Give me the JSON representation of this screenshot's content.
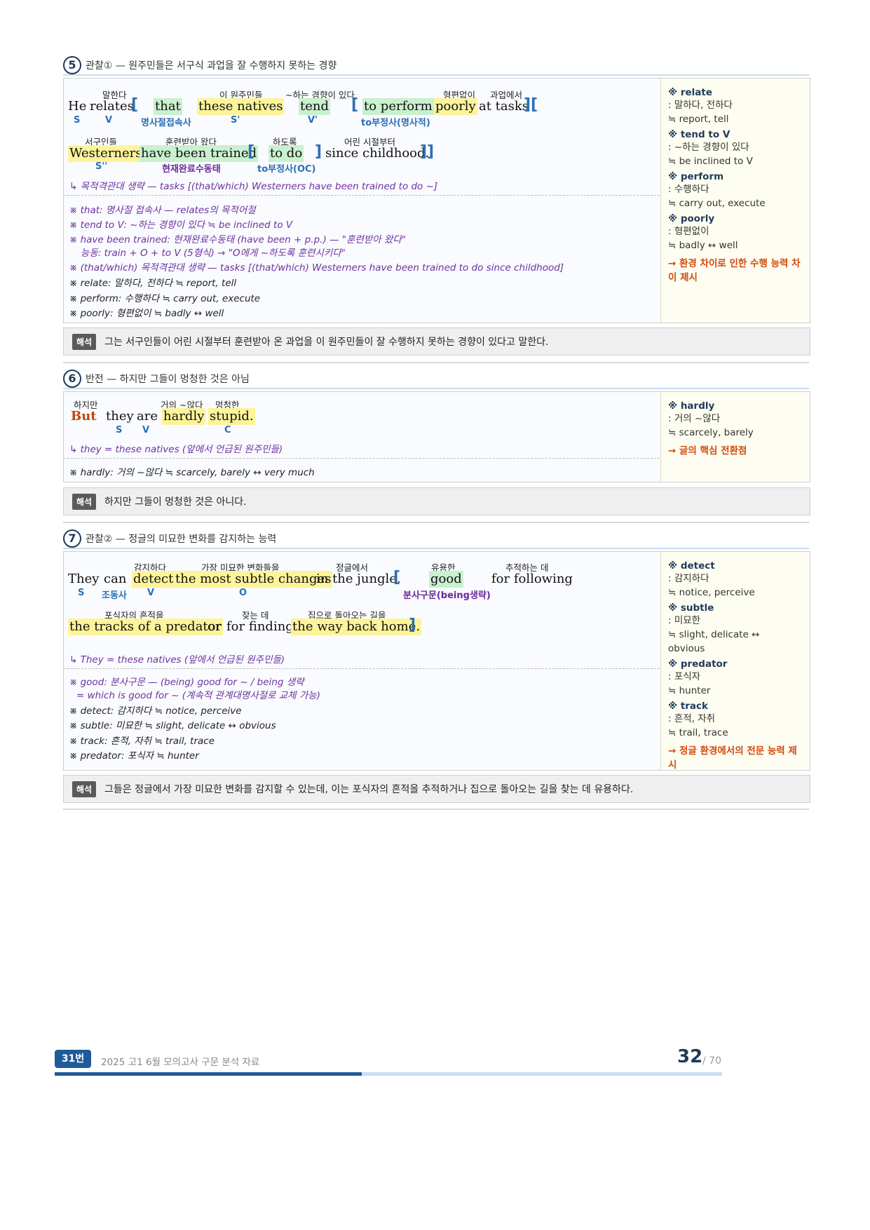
{
  "s5": {
    "num": "5",
    "title": "관찰① — 원주민들은 서구식 과업을 잘 수행하지 못하는 경향",
    "r1": {
      "he": "He",
      "relates": "relates",
      "that": "that",
      "these_natives": "these natives",
      "tend": "tend",
      "to_perform": "to perform",
      "poorly": "poorly",
      "at_tasks": "at tasks",
      "g_relates": "말한다",
      "g_these": "이 원주민들",
      "g_tend": "~하는 경향이 있다",
      "g_poorly": "형편없이",
      "g_tasks": "과업에서",
      "l_s": "S",
      "l_v": "V",
      "l_that": "명사절접속사",
      "l_s2": "S'",
      "l_v2": "V'",
      "l_toperf": "to부정사(명사적)"
    },
    "r2": {
      "westerners": "Westerners",
      "trained": "have been trained",
      "to_do": "to do",
      "since": "since childhood.",
      "g_west": "서구인들",
      "g_trained": "훈련받아 왔다",
      "g_todo": "하도록",
      "g_since": "어린 시절부터",
      "l_s3": "S''",
      "l_trained": "현재완료수동태",
      "l_todo": "to부정사(OC)"
    },
    "arrow_note": "↳ 목적격관대 생략 — tasks [(that/which) Westerners have been trained to do ~]",
    "notes": [
      "※ that: 명사절 접속사 — relates의 목적어절",
      "※ tend to V: ~하는 경향이 있다 ≒ be inclined to V",
      "※ have been trained: 현재완료수동태 (have been + p.p.) — \"훈련받아 왔다\"",
      "능동: train + O + to V (5형식) → \"O에게 ~하도록 훈련시키다\"",
      "※ (that/which) 목적격관대 생략 — tasks [(that/which) Westerners have been trained to do since childhood]",
      "※ relate: 말하다, 전하다 ≒ report, tell",
      "※ perform: 수행하다 ≒ carry out, execute",
      "※ poorly: 형편없이 ≒ badly ↔ well"
    ],
    "side": [
      {
        "term": "※ relate",
        "lines": [
          ": 말하다, 전하다",
          "≒ report, tell"
        ]
      },
      {
        "term": "※ tend to V",
        "lines": [
          ": ~하는 경향이 있다",
          "≒ be inclined to V"
        ]
      },
      {
        "term": "※ perform",
        "lines": [
          ": 수행하다",
          "≒ carry out, execute"
        ]
      },
      {
        "term": "※ poorly",
        "lines": [
          ": 형편없이",
          "≒ badly ↔ well"
        ]
      }
    ],
    "side_foot": "→ 환경 차이로 인한 수행 능력 차이 제시",
    "trans_badge": "해석",
    "trans": "그는 서구인들이 어린 시절부터 훈련받아 온 과업을 이 원주민들이 잘 수행하지 못하는 경향이 있다고 말한다."
  },
  "s6": {
    "num": "6",
    "title": "반전 — 하지만 그들이 멍청한 것은 아님",
    "r1": {
      "but": "But",
      "they": "they",
      "are": "are",
      "hardly": "hardly",
      "stupid": "stupid.",
      "g_but": "하지만",
      "g_hardly": "거의 ~않다",
      "g_stupid": "멍청한",
      "l_s": "S",
      "l_v": "V",
      "l_c": "C"
    },
    "arrow_note": "↳ they = these natives (앞에서 언급된 원주민들)",
    "notes": [
      "※ hardly: 거의 ~않다 ≒ scarcely, barely ↔ very much"
    ],
    "side": [
      {
        "term": "※ hardly",
        "lines": [
          ": 거의 ~않다",
          "≒ scarcely, barely"
        ]
      }
    ],
    "side_foot": "→ 글의 핵심 전환점",
    "trans_badge": "해석",
    "trans": "하지만 그들이 멍청한 것은 아니다."
  },
  "s7": {
    "num": "7",
    "title": "관찰② — 정글의 미묘한 변화를 감지하는 능력",
    "r1": {
      "they": "They",
      "can": "can",
      "detect": "detect",
      "changes": "the most subtle changes",
      "jungle": "in the jungle,",
      "good": "good",
      "following": "for following",
      "g_detect": "감지하다",
      "g_changes": "가장 미묘한 변화들을",
      "g_jungle": "정글에서",
      "g_good": "유용한",
      "g_following": "추적하는 데",
      "l_s": "S",
      "l_aux": "조동사",
      "l_v": "V",
      "l_o": "O",
      "l_good": "분사구문(being생략)"
    },
    "r2": {
      "tracks": "the tracks of a predator",
      "or": "or",
      "finding": "for finding",
      "way": "the way back home.",
      "g_tracks": "포식자의 흔적을",
      "g_finding": "찾는 데",
      "g_way": "집으로 돌아오는 길을"
    },
    "arrow_note": "↳ They = these natives (앞에서 언급된 원주민들)",
    "notes": [
      "※ good: 분사구문 — (being) good for ~ / being 생략",
      "= which is good for ~ (계속적 관계대명사절로 교체 가능)",
      "※ detect: 감지하다 ≒ notice, perceive",
      "※ subtle: 미묘한 ≒ slight, delicate ↔ obvious",
      "※ track: 흔적, 자취 ≒ trail, trace",
      "※ predator: 포식자 ≒ hunter"
    ],
    "side": [
      {
        "term": "※ detect",
        "lines": [
          ": 감지하다",
          "≒ notice, perceive"
        ]
      },
      {
        "term": "※ subtle",
        "lines": [
          ": 미묘한",
          "≒ slight, delicate ↔",
          "obvious"
        ]
      },
      {
        "term": "※ predator",
        "lines": [
          ": 포식자",
          "≒ hunter"
        ]
      },
      {
        "term": "※ track",
        "lines": [
          ": 흔적, 자취",
          "≒ trail, trace"
        ]
      }
    ],
    "side_foot": "→ 정글 환경에서의 전문 능력 제시",
    "trans_badge": "해석",
    "trans": "그들은 정글에서 가장 미묘한 변화를 감지할 수 있는데, 이는 포식자의 흔적을 추적하거나 집으로 돌아오는 길을 찾는 데 유용하다."
  },
  "footer": {
    "badge": "31번",
    "title": "2025 고1 6월 모의고사 구문 분석 자료",
    "page": "32",
    "total": "/ 70",
    "progress": 0.46
  }
}
